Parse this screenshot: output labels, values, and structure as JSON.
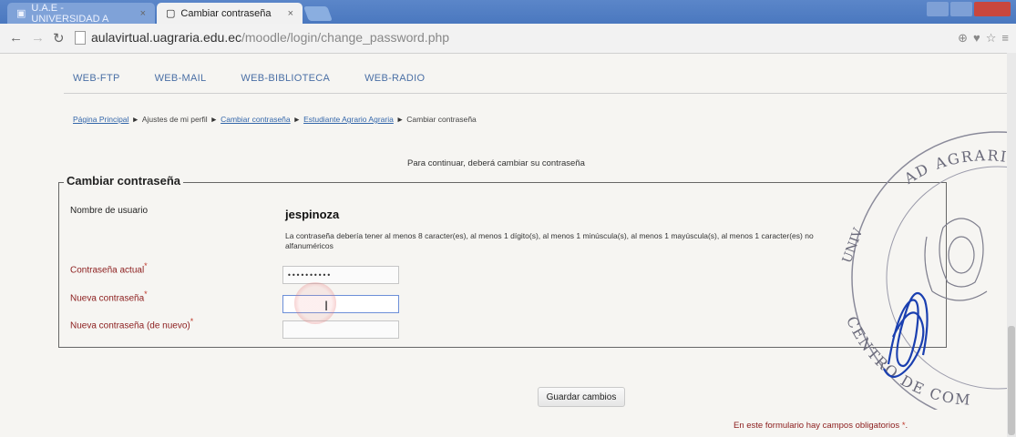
{
  "browser": {
    "tabs": [
      {
        "title": "U.A.E - UNIVERSIDAD A",
        "active": false
      },
      {
        "title": "Cambiar contraseña",
        "active": true
      }
    ],
    "url_host": "aulavirtual.uagraria.edu.ec",
    "url_path": "/moodle/login/change_password.php"
  },
  "site_menu": [
    "WEB-FTP",
    "WEB-MAIL",
    "WEB-BIBLIOTECA",
    "WEB-RADIO"
  ],
  "breadcrumb": [
    {
      "label": "Página Principal",
      "link": true
    },
    {
      "label": "Ajustes de mi perfil",
      "link": false
    },
    {
      "label": "Cambiar contraseña",
      "link": true
    },
    {
      "label": "Estudiante Agrario Agraria",
      "link": true
    },
    {
      "label": "Cambiar contraseña",
      "link": false
    }
  ],
  "breadcrumb_sep": "►",
  "notice": "Para continuar, deberá cambiar su contraseña",
  "form": {
    "legend": "Cambiar contraseña",
    "username_label": "Nombre de usuario",
    "username_value": "jespinoza",
    "policy": "La contraseña debería tener al menos 8 caracter(es), al menos 1 dígito(s), al menos 1 minúscula(s), al menos 1 mayúscula(s), al menos 1 caracter(es) no alfanuméricos",
    "current_label": "Contraseña actual",
    "current_value": "••••••••••",
    "new_label": "Nueva contraseña",
    "new_value": "",
    "repeat_label": "Nueva contraseña (de nuevo)",
    "repeat_value": "",
    "required_mark": "*",
    "save_label": "Guardar cambios",
    "required_note": "En este formulario hay campos obligatorios"
  },
  "stamp": {
    "text_top": "AD AGRARIA",
    "text_left": "UNIV",
    "text_bottom": "CENTRO DE COM"
  },
  "colors": {
    "link": "#3366aa",
    "required": "#8b1c1c",
    "tabstrip": "#4a78bf"
  }
}
